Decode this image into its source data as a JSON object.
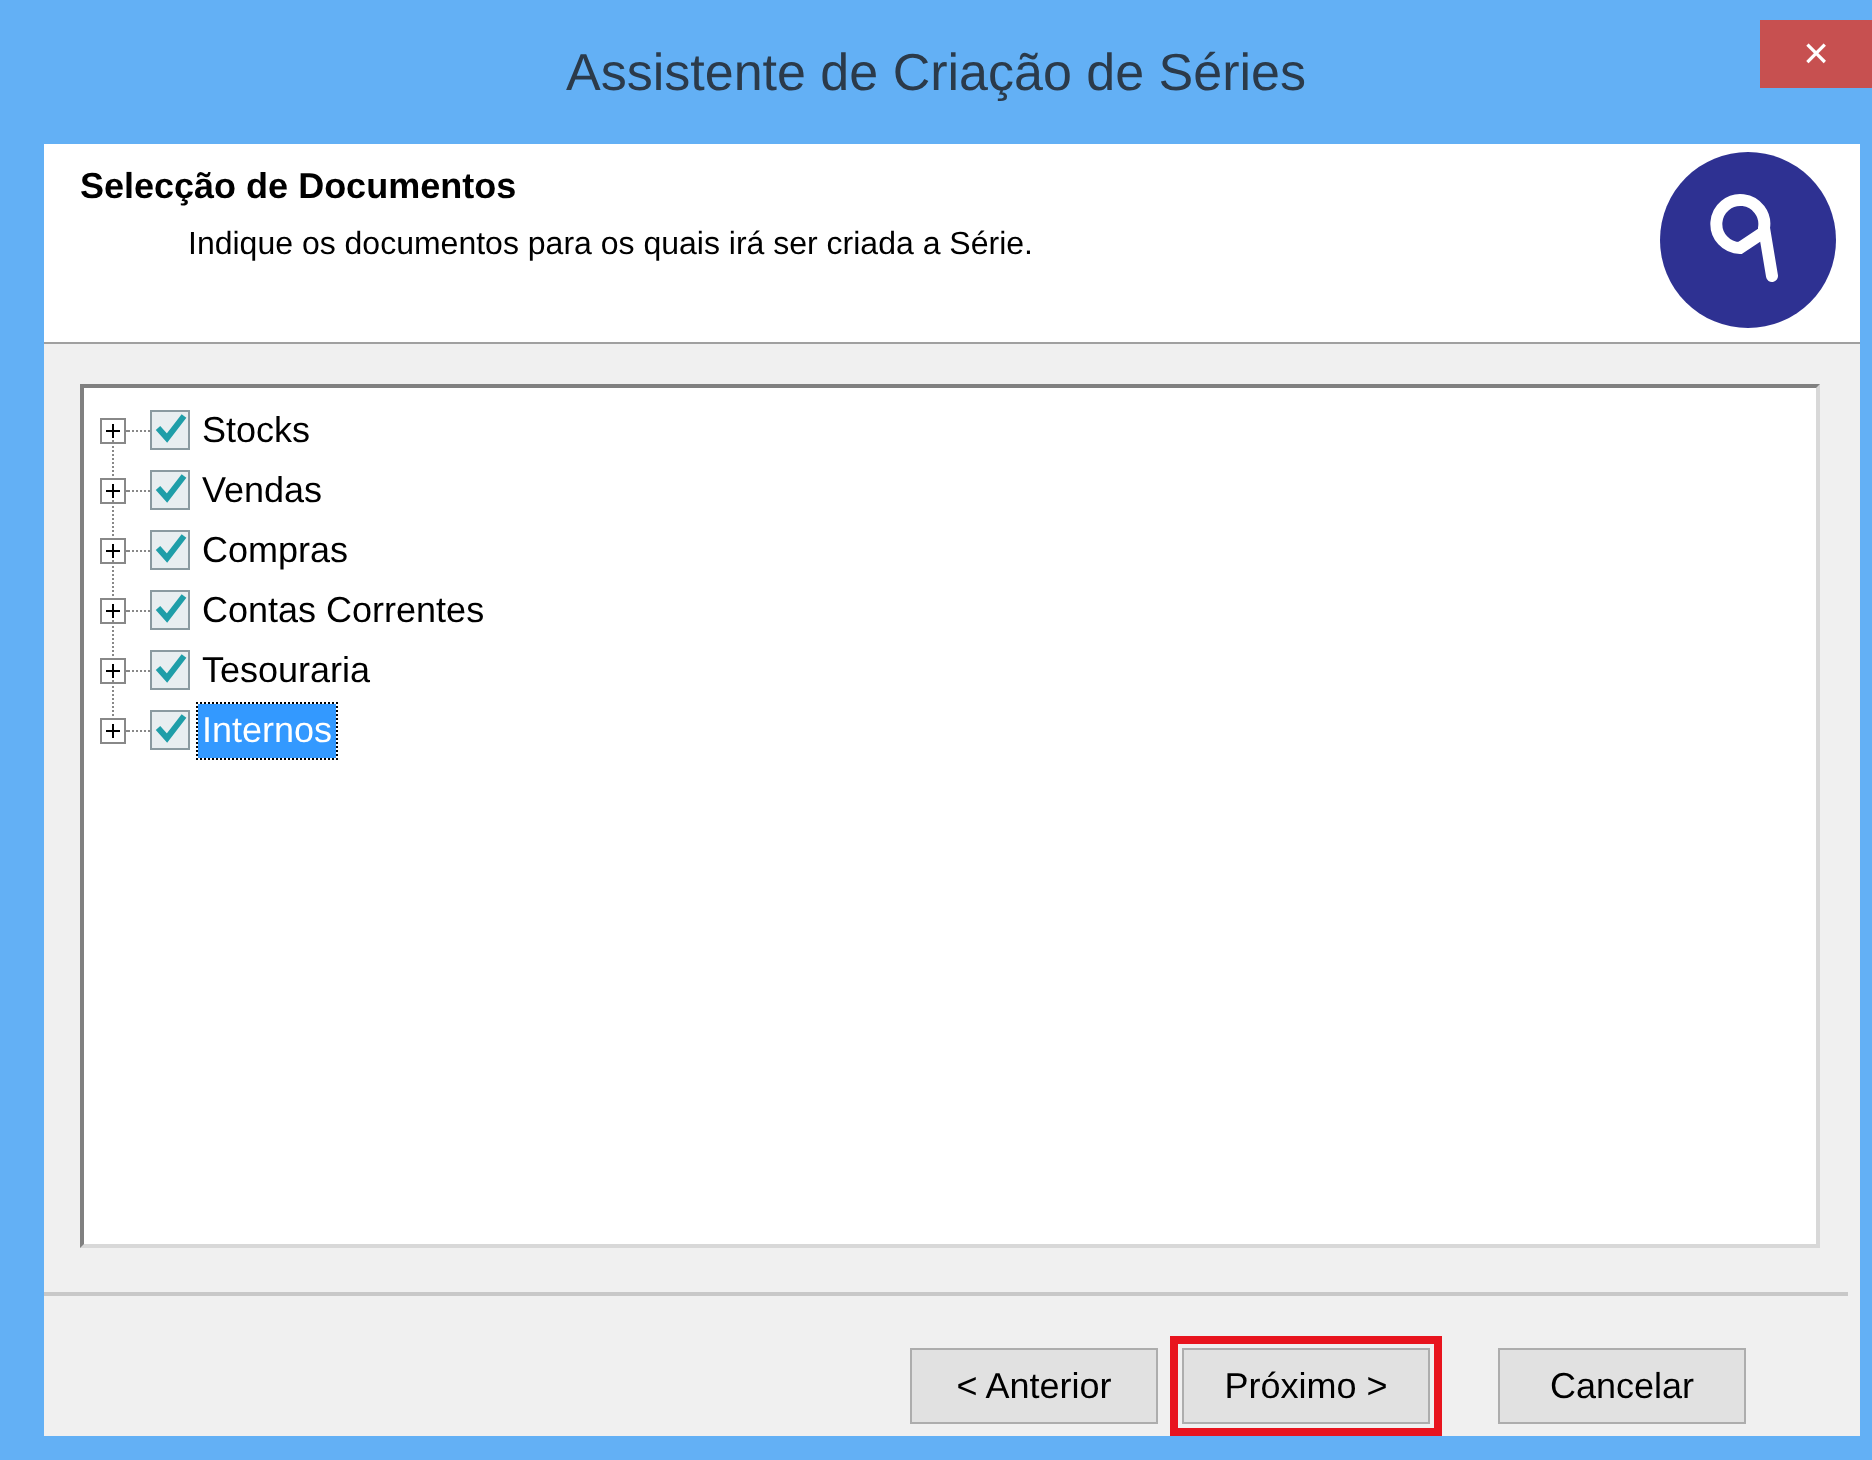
{
  "window": {
    "title": "Assistente de Criação de Séries",
    "close": "×"
  },
  "header": {
    "title": "Selecção de Documentos",
    "subtitle": "Indique os documentos para os quais irá ser criada a Série."
  },
  "tree": [
    {
      "label": "Stocks",
      "checked": true,
      "expanded": false,
      "selected": false
    },
    {
      "label": "Vendas",
      "checked": true,
      "expanded": false,
      "selected": false
    },
    {
      "label": "Compras",
      "checked": true,
      "expanded": false,
      "selected": false
    },
    {
      "label": "Contas Correntes",
      "checked": true,
      "expanded": false,
      "selected": false
    },
    {
      "label": "Tesouraria",
      "checked": true,
      "expanded": false,
      "selected": false
    },
    {
      "label": "Internos",
      "checked": true,
      "expanded": false,
      "selected": true
    }
  ],
  "buttons": [
    {
      "label": "< Anterior",
      "highlighted": false
    },
    {
      "label": "Próximo >",
      "highlighted": true
    },
    {
      "label": "Cancelar",
      "highlighted": false
    }
  ]
}
